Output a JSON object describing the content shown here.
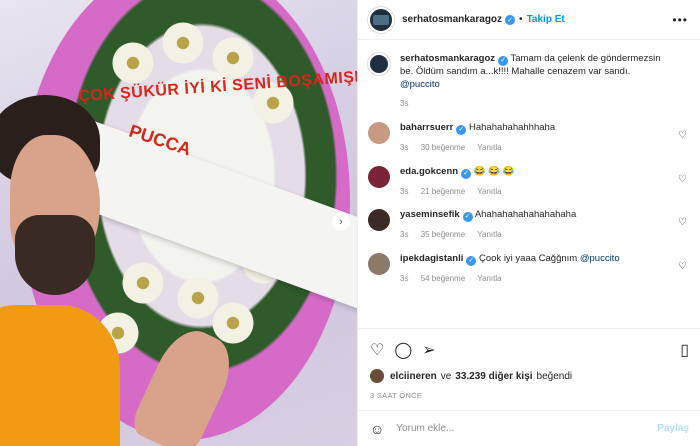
{
  "header": {
    "username": "serhatosmankaragoz",
    "follow_label": "Takip Et",
    "more_icon": "more-horizontal-icon"
  },
  "media": {
    "ribbon_line1": "ÇOK ŞÜKÜR İYİ Kİ SENİ BOŞAMIŞIM",
    "ribbon_line2": "PUCCA"
  },
  "comments": [
    {
      "username": "serhatosmankaragoz",
      "verified": true,
      "text": "Tamam da çelenk de göndermezsin be. Öldüm sandım a...k!!!! Mahalle cenazem var sandı.",
      "mention": "@puccito",
      "time": "3s",
      "likes": "",
      "reply": "",
      "avatar_color": "#1f2f3f"
    },
    {
      "username": "baharrsuerr",
      "verified": true,
      "text": "Hahahahahahhhaha",
      "mention": "",
      "time": "3s",
      "likes": "30 beğenme",
      "reply": "Yanıtla",
      "avatar_color": "#c89a82"
    },
    {
      "username": "eda.gokcenn",
      "verified": true,
      "text": "😂 😂 😂",
      "mention": "",
      "time": "3s",
      "likes": "21 beğenme",
      "reply": "Yanıtla",
      "avatar_color": "#7a2435"
    },
    {
      "username": "yaseminsefik",
      "verified": true,
      "text": "Ahahahahahahahahaha",
      "mention": "",
      "time": "3s",
      "likes": "35 beğenme",
      "reply": "Yanıtla",
      "avatar_color": "#3b2a26"
    },
    {
      "username": "ipekdagistanli",
      "verified": true,
      "text": "Çook iyi yaaa Cağğnım",
      "mention": "@puccito",
      "time": "3s",
      "likes": "54 beğenme",
      "reply": "Yanıtla",
      "avatar_color": "#8a7a6a"
    }
  ],
  "likes": {
    "liker": "elciineren",
    "connector": "ve",
    "count": "33.239 diğer kişi",
    "suffix": "beğendi"
  },
  "timestamp": "3 SAAT ÖNCE",
  "add_comment": {
    "placeholder": "Yorum ekle...",
    "post_label": "Paylaş"
  },
  "icons": {
    "like": "heart-icon",
    "comment": "comment-icon",
    "share": "share-icon",
    "save": "bookmark-icon",
    "emoji": "emoji-icon"
  },
  "colors": {
    "accent": "#0095f6",
    "verified": "#3897f0",
    "muted": "#8e8e8e"
  }
}
